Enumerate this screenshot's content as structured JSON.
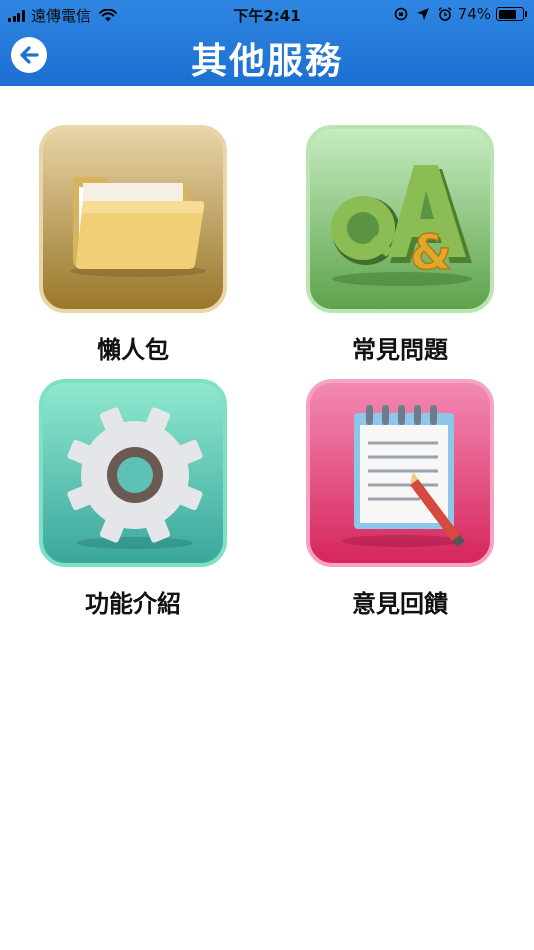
{
  "status_bar": {
    "carrier": "遠傳電信",
    "time": "下午2:41",
    "battery_percent": "74%",
    "battery_level": 0.74
  },
  "header": {
    "title": "其他服務",
    "back_icon": "arrow-left-circle-icon"
  },
  "menu": [
    {
      "label": "懶人包",
      "icon": "folder-icon",
      "colors": [
        "#e4cda0",
        "#9d7b2e"
      ]
    },
    {
      "label": "常見問題",
      "icon": "qa-icon",
      "colors": [
        "#c3ebbd",
        "#5ea44e"
      ],
      "icon_text": "Q&A"
    },
    {
      "label": "功能介紹",
      "icon": "gear-icon",
      "colors": [
        "#8ee8cd",
        "#3aa89e"
      ]
    },
    {
      "label": "意見回饋",
      "icon": "notepad-pencil-icon",
      "colors": [
        "#f48bb5",
        "#d8285e"
      ]
    }
  ]
}
